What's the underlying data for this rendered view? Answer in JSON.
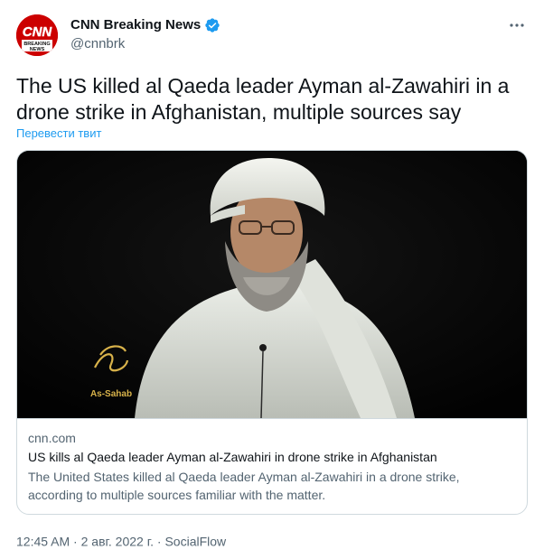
{
  "account": {
    "name": "CNN Breaking News",
    "handle": "@cnnbrk",
    "avatar_logo": "CNN",
    "avatar_sub1": "BREAKING",
    "avatar_sub2": "NEWS",
    "verified_icon": "verified-badge-icon"
  },
  "tweet": {
    "text": "The US killed al Qaeda leader Ayman al-Zawahiri in a drone strike in Afghanistan, multiple sources say",
    "translate_label": "Перевести твит"
  },
  "card": {
    "image_watermark": "As-Sahab",
    "domain": "cnn.com",
    "title": "US kills al Qaeda leader Ayman al-Zawahiri in drone strike in Afghanistan",
    "description": "The United States killed al Qaeda leader Ayman al-Zawahiri in a drone strike, according to multiple sources familiar with the matter."
  },
  "meta": {
    "time": "12:45 AM",
    "separator": "·",
    "date": "2 авг. 2022 г.",
    "source": "SocialFlow"
  },
  "colors": {
    "accent": "#1d9bf0",
    "cnn_red": "#cc0000",
    "secondary_text": "#536471"
  }
}
